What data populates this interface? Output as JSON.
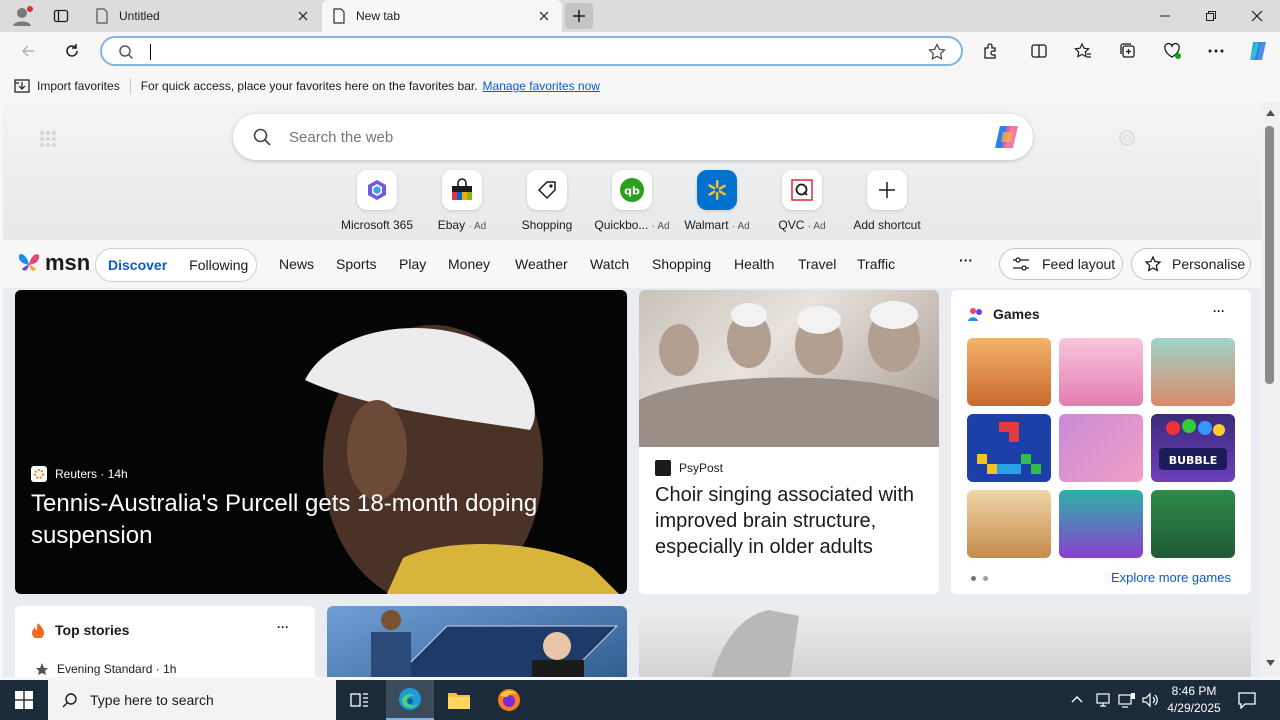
{
  "browser": {
    "tabs": [
      {
        "title": "Untitled",
        "active": false
      },
      {
        "title": "New tab",
        "active": true
      }
    ],
    "address_value": "",
    "favorites_bar": {
      "import_label": "Import favorites",
      "hint": "For quick access, place your favorites here on the favorites bar.",
      "manage_link": "Manage favorites now"
    }
  },
  "newtab": {
    "search_placeholder": "Search the web",
    "shortcuts": [
      {
        "label": "Microsoft 365",
        "ad": ""
      },
      {
        "label": "Ebay",
        "ad": "· Ad"
      },
      {
        "label": "Shopping",
        "ad": ""
      },
      {
        "label": "Quickbo...",
        "ad": "· Ad"
      },
      {
        "label": "Walmart",
        "ad": "· Ad"
      },
      {
        "label": "QVC",
        "ad": "· Ad"
      },
      {
        "label": "Add shortcut",
        "ad": ""
      }
    ]
  },
  "msn": {
    "logo": "msn",
    "pill": {
      "discover": "Discover",
      "following": "Following"
    },
    "nav": [
      "News",
      "Sports",
      "Play",
      "Money",
      "Weather",
      "Watch",
      "Shopping",
      "Health",
      "Travel",
      "Traffic"
    ],
    "more": "···",
    "feed_layout": "Feed layout",
    "personalise": "Personalise"
  },
  "cards": {
    "hero": {
      "source": "Reuters",
      "time": "· 14h",
      "title": "Tennis-Australia's Purcell gets 18-month doping suspension"
    },
    "card2": {
      "source": "PsyPost",
      "title": "Choir singing associated with improved brain structure, especially in older adults"
    },
    "games": {
      "title": "Games",
      "more": "···",
      "explore": "Explore more games"
    },
    "topstories": {
      "title": "Top stories",
      "more": "···",
      "source": "Evening Standard",
      "time": "· 1h"
    }
  },
  "taskbar": {
    "search_placeholder": "Type here to search",
    "time": "8:46 PM",
    "date": "4/29/2025"
  },
  "colors": {
    "accent": "#0a5bd3",
    "taskbar": "#1c2b3a"
  }
}
